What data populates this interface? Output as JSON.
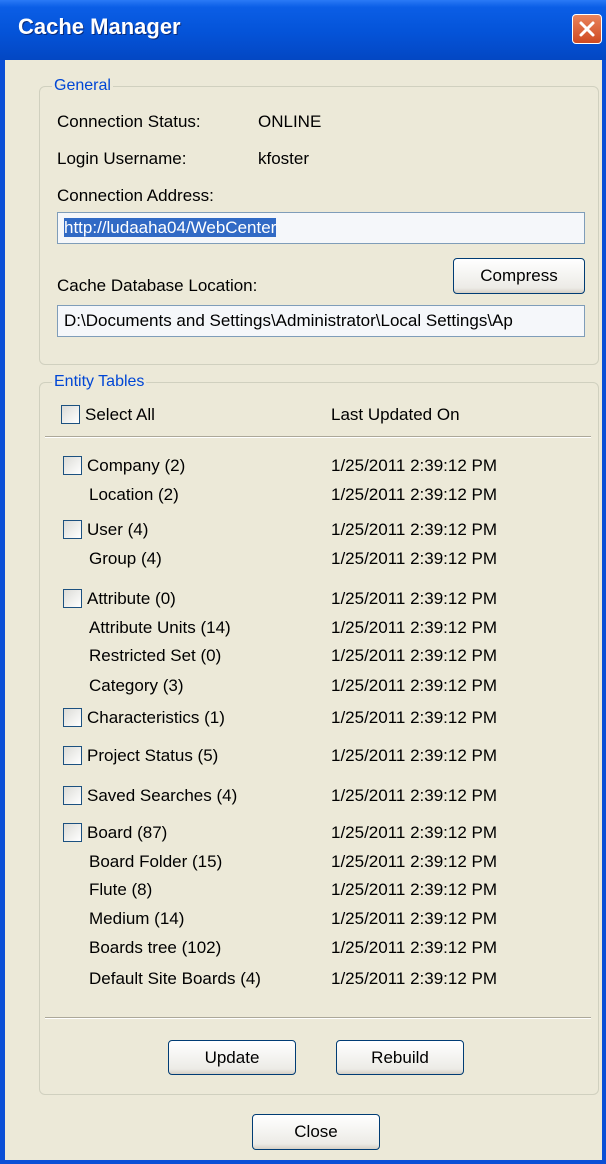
{
  "window": {
    "title": "Cache Manager"
  },
  "general": {
    "legend": "General",
    "status_label": "Connection Status:",
    "status_value": "ONLINE",
    "login_label": "Login Username:",
    "login_value": "kfoster",
    "address_label": "Connection Address:",
    "address_value": "http://ludaaha04/WebCenter",
    "cache_label": "Cache Database Location:",
    "compress_label": "Compress",
    "cache_value": "D:\\Documents and Settings\\Administrator\\Local Settings\\Ap"
  },
  "entities": {
    "legend": "Entity Tables",
    "select_all": "Select All",
    "col_updated": "Last Updated On",
    "rows": [
      {
        "label": "Company (2)",
        "date": "1/25/2011 2:39:12 PM",
        "checkbox": true
      },
      {
        "label": "Location (2)",
        "date": "1/25/2011 2:39:12 PM",
        "checkbox": false
      },
      {
        "label": "User (4)",
        "date": "1/25/2011 2:39:12 PM",
        "checkbox": true
      },
      {
        "label": "Group (4)",
        "date": "1/25/2011 2:39:12 PM",
        "checkbox": false
      },
      {
        "label": "Attribute (0)",
        "date": "1/25/2011 2:39:12 PM",
        "checkbox": true
      },
      {
        "label": "Attribute Units (14)",
        "date": "1/25/2011 2:39:12 PM",
        "checkbox": false
      },
      {
        "label": "Restricted Set (0)",
        "date": "1/25/2011 2:39:12 PM",
        "checkbox": false
      },
      {
        "label": "Category (3)",
        "date": "1/25/2011 2:39:12 PM",
        "checkbox": false
      },
      {
        "label": "Characteristics (1)",
        "date": "1/25/2011 2:39:12 PM",
        "checkbox": true
      },
      {
        "label": "Project Status (5)",
        "date": "1/25/2011 2:39:12 PM",
        "checkbox": true
      },
      {
        "label": "Saved Searches (4)",
        "date": "1/25/2011 2:39:12 PM",
        "checkbox": true
      },
      {
        "label": "Board (87)",
        "date": "1/25/2011 2:39:12 PM",
        "checkbox": true
      },
      {
        "label": "Board Folder (15)",
        "date": "1/25/2011 2:39:12 PM",
        "checkbox": false
      },
      {
        "label": "Flute (8)",
        "date": "1/25/2011 2:39:12 PM",
        "checkbox": false
      },
      {
        "label": "Medium (14)",
        "date": "1/25/2011 2:39:12 PM",
        "checkbox": false
      },
      {
        "label": "Boards tree (102)",
        "date": "1/25/2011 2:39:12 PM",
        "checkbox": false
      },
      {
        "label": "Default Site Boards (4)",
        "date": "1/25/2011 2:39:12 PM",
        "checkbox": false
      }
    ],
    "update_label": "Update",
    "rebuild_label": "Rebuild"
  },
  "footer": {
    "close_label": "Close"
  }
}
